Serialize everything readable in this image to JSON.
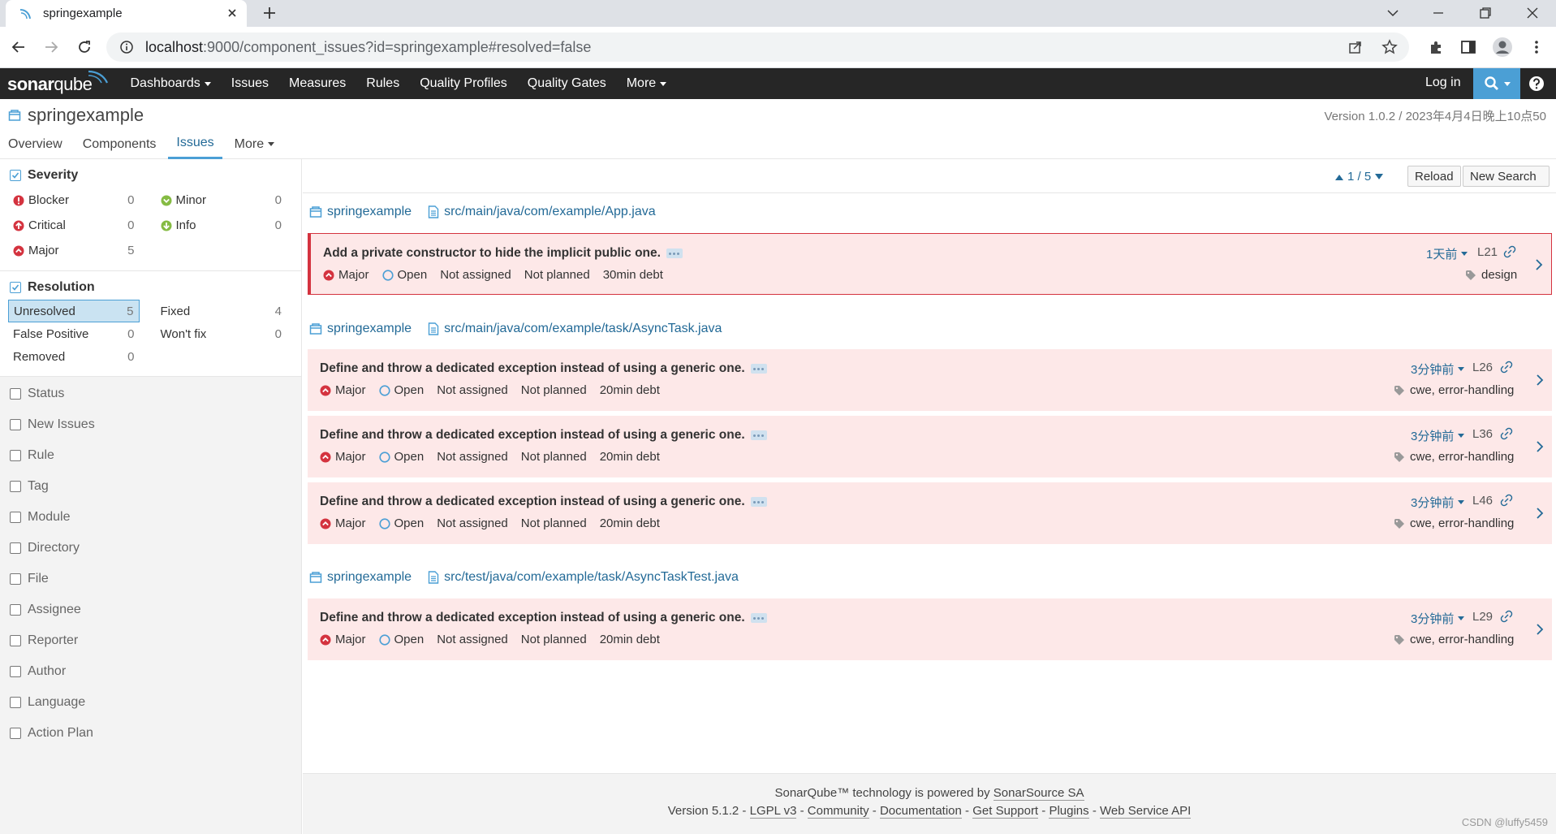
{
  "browser": {
    "tab_title": "springexample",
    "url_host": "localhost",
    "url_rest": ":9000/component_issues?id=springexample#resolved=false"
  },
  "sonar_nav": {
    "logo_bold": "sonar",
    "logo_light": "qube",
    "items": [
      "Dashboards",
      "Issues",
      "Measures",
      "Rules",
      "Quality Profiles",
      "Quality Gates",
      "More"
    ],
    "login": "Log in"
  },
  "project": {
    "name": "springexample",
    "version": "Version 1.0.2 / 2023年4月4日晚上10点50",
    "tabs": [
      "Overview",
      "Components",
      "Issues",
      "More"
    ],
    "active_tab": "Issues"
  },
  "severity_facet": {
    "title": "Severity",
    "items": [
      {
        "label": "Blocker",
        "count": "0"
      },
      {
        "label": "Minor",
        "count": "0"
      },
      {
        "label": "Critical",
        "count": "0"
      },
      {
        "label": "Info",
        "count": "0"
      },
      {
        "label": "Major",
        "count": "5"
      }
    ]
  },
  "resolution_facet": {
    "title": "Resolution",
    "items": [
      {
        "label": "Unresolved",
        "count": "5"
      },
      {
        "label": "Fixed",
        "count": "4"
      },
      {
        "label": "False Positive",
        "count": "0"
      },
      {
        "label": "Won't fix",
        "count": "0"
      },
      {
        "label": "Removed",
        "count": "0"
      }
    ]
  },
  "collapsed_facets": [
    "Status",
    "New Issues",
    "Rule",
    "Tag",
    "Module",
    "Directory",
    "File",
    "Assignee",
    "Reporter",
    "Author",
    "Language",
    "Action Plan"
  ],
  "toolbar": {
    "paging": "1 / 5",
    "reload": "Reload",
    "new_search": "New Search"
  },
  "groups": [
    {
      "project": "springexample",
      "file": "src/main/java/com/example/App.java"
    },
    {
      "project": "springexample",
      "file": "src/main/java/com/example/task/AsyncTask.java"
    },
    {
      "project": "springexample",
      "file": "src/test/java/com/example/task/AsyncTaskTest.java"
    }
  ],
  "issues": [
    {
      "message": "Add a private constructor to hide the implicit public one.",
      "severity": "Major",
      "status": "Open",
      "assignee": "Not assigned",
      "plan": "Not planned",
      "debt": "30min debt",
      "when": "1天前",
      "line": "L21",
      "tags": "design"
    },
    {
      "message": "Define and throw a dedicated exception instead of using a generic one.",
      "severity": "Major",
      "status": "Open",
      "assignee": "Not assigned",
      "plan": "Not planned",
      "debt": "20min debt",
      "when": "3分钟前",
      "line": "L26",
      "tags": "cwe, error-handling"
    },
    {
      "message": "Define and throw a dedicated exception instead of using a generic one.",
      "severity": "Major",
      "status": "Open",
      "assignee": "Not assigned",
      "plan": "Not planned",
      "debt": "20min debt",
      "when": "3分钟前",
      "line": "L36",
      "tags": "cwe, error-handling"
    },
    {
      "message": "Define and throw a dedicated exception instead of using a generic one.",
      "severity": "Major",
      "status": "Open",
      "assignee": "Not assigned",
      "plan": "Not planned",
      "debt": "20min debt",
      "when": "3分钟前",
      "line": "L46",
      "tags": "cwe, error-handling"
    },
    {
      "message": "Define and throw a dedicated exception instead of using a generic one.",
      "severity": "Major",
      "status": "Open",
      "assignee": "Not assigned",
      "plan": "Not planned",
      "debt": "20min debt",
      "when": "3分钟前",
      "line": "L29",
      "tags": "cwe, error-handling"
    }
  ],
  "footer": {
    "powered_prefix": "SonarQube™ technology is powered by ",
    "powered_link": "SonarSource SA",
    "version": "Version 5.1.2",
    "links": [
      "LGPL v3",
      "Community",
      "Documentation",
      "Get Support",
      "Plugins",
      "Web Service API"
    ],
    "sep": " - "
  },
  "watermark": "CSDN @luffy5459",
  "colors": {
    "major": "#d4333f",
    "minor_info": "#85bb43",
    "link": "#236a97",
    "issue_bg": "#fde8e8"
  }
}
